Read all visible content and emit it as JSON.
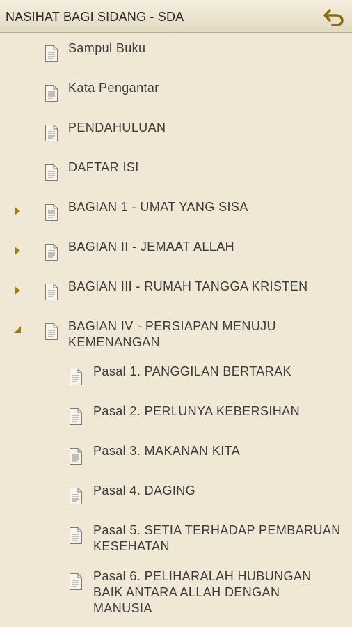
{
  "app": {
    "title": "NASIHAT BAGI SIDANG - SDA"
  },
  "toc": {
    "items": [
      {
        "label": "Sampul Buku",
        "toggle": "none"
      },
      {
        "label": "Kata Pengantar",
        "toggle": "none"
      },
      {
        "label": "PENDAHULUAN",
        "toggle": "none"
      },
      {
        "label": "DAFTAR ISI",
        "toggle": "none"
      },
      {
        "label": "BAGIAN 1 - UMAT YANG SISA",
        "toggle": "collapsed"
      },
      {
        "label": "BAGIAN II - JEMAAT ALLAH",
        "toggle": "collapsed"
      },
      {
        "label": "BAGIAN III - RUMAH TANGGA KRISTEN",
        "toggle": "collapsed"
      },
      {
        "label": "BAGIAN IV - PERSIAPAN MENUJU\nKEMENANGAN",
        "toggle": "expanded"
      },
      {
        "label": "Pasal 1. PANGGILAN BERTARAK",
        "toggle": "none"
      },
      {
        "label": "Pasal 2. PERLUNYA KEBERSIHAN",
        "toggle": "none"
      },
      {
        "label": "Pasal 3. MAKANAN KITA",
        "toggle": "none"
      },
      {
        "label": "Pasal 4. DAGING",
        "toggle": "none"
      },
      {
        "label": "Pasal 5. SETIA TERHADAP PEMBARUAN\nKESEHATAN",
        "toggle": "none"
      },
      {
        "label": "Pasal 6. PELIHARALAH HUBUNGAN\nBAIK ANTARA ALLAH DENGAN\nMANUSIA",
        "toggle": "none"
      }
    ]
  },
  "icons": {
    "back": "undo-arrow-icon",
    "document": "document-icon",
    "expand": "triangle-right-icon",
    "collapse": "triangle-down-icon"
  },
  "colors": {
    "background": "#f0e8d4",
    "accent": "#9a7b16",
    "text": "#3c3c3c"
  }
}
